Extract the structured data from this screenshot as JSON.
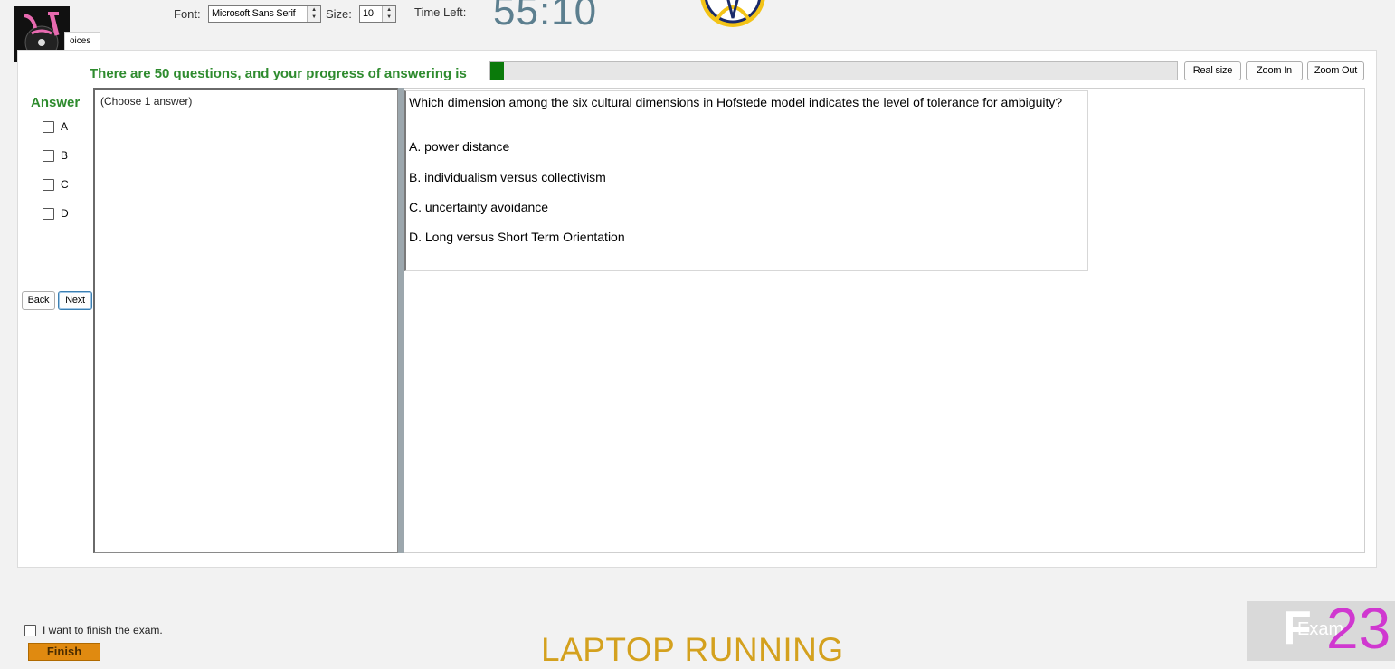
{
  "toolbar": {
    "font_label": "Font:",
    "font_value": "Microsoft Sans Serif",
    "size_label": "Size:",
    "size_value": "10",
    "time_left_label": "Time Left:",
    "time_left_value": "55:10"
  },
  "tab": {
    "label": "oices"
  },
  "progress": {
    "text": "There are 50 questions, and your progress of answering is",
    "fraction": 0.02,
    "color": "#0a7a0a"
  },
  "zoom_buttons": {
    "real_size": "Real size",
    "zoom_in": "Zoom In",
    "zoom_out": "Zoom Out"
  },
  "answer": {
    "title": "Answer",
    "options": [
      "A",
      "B",
      "C",
      "D"
    ]
  },
  "nav": {
    "back": "Back",
    "next": "Next"
  },
  "choose_hint": "(Choose 1 answer)",
  "question": {
    "text": "Which dimension among the six cultural dimensions in Hofstede model indicates the level of tolerance for ambiguity?",
    "options": [
      "A.  power distance",
      "B.  individualism versus collectivism",
      "C.  uncertainty avoidance",
      "D.  Long versus Short Term Orientation"
    ]
  },
  "footer": {
    "finish_check_label": "I want to finish the exam.",
    "finish_button": "Finish",
    "overlay_text": "LAPTOP RUNNING",
    "watermark_number": "23",
    "watermark_word": "Exam"
  },
  "colors": {
    "accent_green": "#2e8b2e",
    "finish_orange": "#e08a10",
    "timer": "#5c7f8f"
  }
}
